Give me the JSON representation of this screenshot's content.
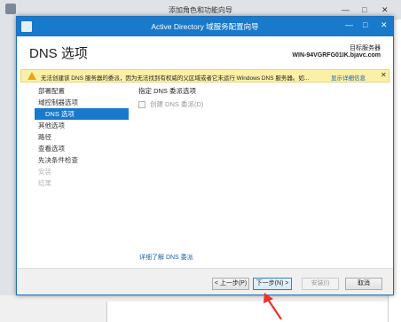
{
  "background_window": {
    "title": "添加角色和功能向导",
    "controls": [
      "—",
      "□",
      "✕"
    ]
  },
  "dialog": {
    "title": "Active Directory 域服务配置向导",
    "controls": [
      "—",
      "□",
      "✕"
    ],
    "page_title": "DNS 选项",
    "target_server_label": "目标服务器",
    "target_server_name": "WIN-94VGRFG01IK.bjavc.com",
    "warning": {
      "text": "无法创建该 DNS 服务器的委派，因为无法找到有权威的父区域或者它未运行 Windows DNS 服务器。如...",
      "more_link": "显示详细信息",
      "close": "✕"
    },
    "nav": [
      {
        "label": "部署配置",
        "state": "normal"
      },
      {
        "label": "域控制器选项",
        "state": "normal"
      },
      {
        "label": "DNS 选项",
        "state": "active"
      },
      {
        "label": "其他选项",
        "state": "normal"
      },
      {
        "label": "路径",
        "state": "normal"
      },
      {
        "label": "查看选项",
        "state": "normal"
      },
      {
        "label": "先决条件检查",
        "state": "normal"
      },
      {
        "label": "安装",
        "state": "disabled"
      },
      {
        "label": "结果",
        "state": "disabled"
      }
    ],
    "section_heading": "指定 DNS 委派选项",
    "create_delegation_label": "创建 DNS 委派(D)",
    "help_link": "详细了解 DNS 委派",
    "buttons": {
      "previous": "< 上一步(P)",
      "next": "下一步(N) >",
      "install": "安装(I)",
      "cancel": "取消"
    }
  },
  "colors": {
    "accent": "#1979ca",
    "warning_bg": "#fcf0a6",
    "arrow": "#e8332c"
  }
}
